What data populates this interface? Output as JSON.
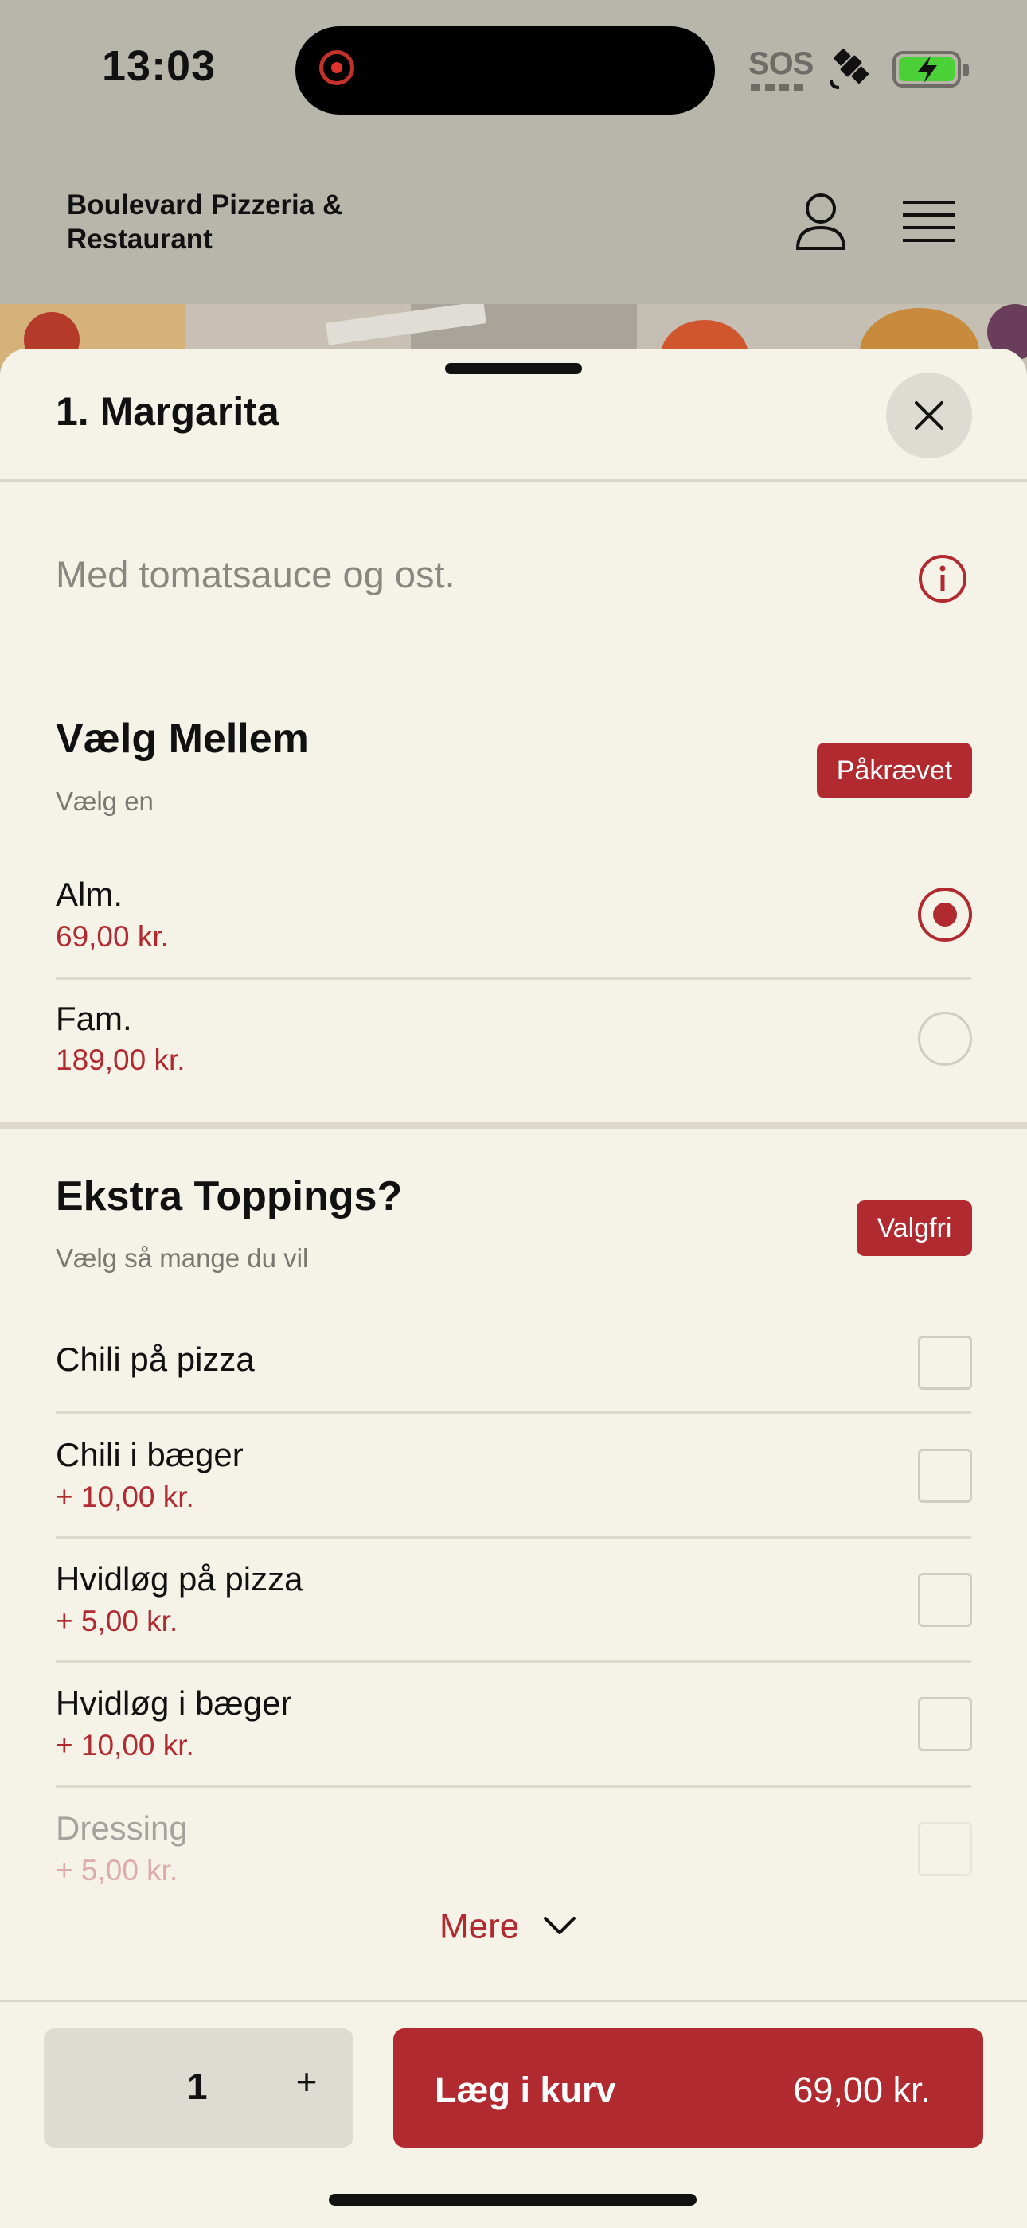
{
  "status_bar": {
    "time": "13:03",
    "sos": "SOS"
  },
  "header": {
    "restaurant_name": "Boulevard Pizzeria & Restaurant"
  },
  "item": {
    "title": "1. Margarita",
    "description": "Med tomatsauce og ost."
  },
  "size_group": {
    "title": "Vælg Mellem",
    "subtitle": "Vælg en",
    "badge": "Påkrævet",
    "options": [
      {
        "label": "Alm.",
        "price": "69,00 kr.",
        "selected": true
      },
      {
        "label": "Fam.",
        "price": "189,00 kr.",
        "selected": false
      }
    ]
  },
  "toppings_group": {
    "title": "Ekstra Toppings?",
    "subtitle": "Vælg så mange du vil",
    "badge": "Valgfri",
    "options": [
      {
        "label": "Chili på pizza",
        "price": ""
      },
      {
        "label": "Chili i bæger",
        "price": "+ 10,00 kr."
      },
      {
        "label": "Hvidløg på pizza",
        "price": "+ 5,00 kr."
      },
      {
        "label": "Hvidløg i bæger",
        "price": "+ 10,00 kr."
      },
      {
        "label": "Dressing",
        "price": "+ 5,00 kr."
      }
    ],
    "more_label": "Mere"
  },
  "footer": {
    "quantity": "1",
    "plus": "+",
    "add_label": "Læg i kurv",
    "add_price": "69,00 kr."
  },
  "colors": {
    "accent": "#b02a30",
    "sheet_bg": "#f5f2e8",
    "header_bg": "#b8b5ab"
  },
  "icons": [
    "close-icon",
    "info-icon",
    "user-icon",
    "menu-icon",
    "chevron-down-icon"
  ]
}
